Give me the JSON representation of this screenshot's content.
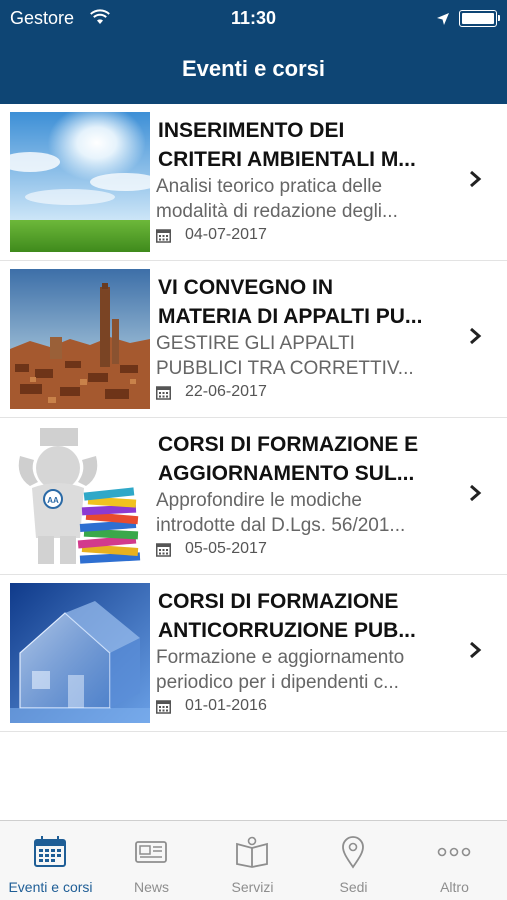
{
  "status_bar": {
    "carrier": "Gestore",
    "time": "11:30"
  },
  "header": {
    "title": "Eventi e corsi"
  },
  "events": [
    {
      "title_line1": "INSERIMENTO DEI",
      "title_line2": "CRITERI AMBIENTALI M...",
      "desc_line1": "Analisi teorico pratica delle",
      "desc_line2": "modalità di redazione degli...",
      "date": "04-07-2017",
      "image": "sky-meadow-photo"
    },
    {
      "title_line1": "VI CONVEGNO IN",
      "title_line2": "MATERIA DI APPALTI PU...",
      "desc_line1": "GESTIRE GLI APPALTI",
      "desc_line2": "PUBBLICI TRA CORRETTIV...",
      "date": "22-06-2017",
      "image": "bologna-towers-photo"
    },
    {
      "title_line1": "CORSI DI FORMAZIONE E",
      "title_line2": "AGGIORNAMENTO SUL...",
      "desc_line1": "Approfondire le modiche",
      "desc_line2": "introdotte dal D.Lgs. 56/201...",
      "date": "05-05-2017",
      "image": "figure-with-books-illustration"
    },
    {
      "title_line1": "CORSI DI FORMAZIONE",
      "title_line2": "ANTICORRUZIONE PUB...",
      "desc_line1": "Formazione e aggiornamento",
      "desc_line2": "periodico per i dipendenti c...",
      "date": "01-01-2016",
      "image": "glass-house-photo"
    }
  ],
  "tabs": [
    {
      "label": "Eventi e corsi",
      "icon": "calendar-icon",
      "active": true
    },
    {
      "label": "News",
      "icon": "newspaper-icon",
      "active": false
    },
    {
      "label": "Servizi",
      "icon": "book-icon",
      "active": false
    },
    {
      "label": "Sedi",
      "icon": "map-pin-icon",
      "active": false
    },
    {
      "label": "Altro",
      "icon": "more-icon",
      "active": false
    }
  ],
  "colors": {
    "header_bg": "#0e4574",
    "tab_active": "#1f5e96",
    "tab_inactive": "#8e8e8e"
  }
}
